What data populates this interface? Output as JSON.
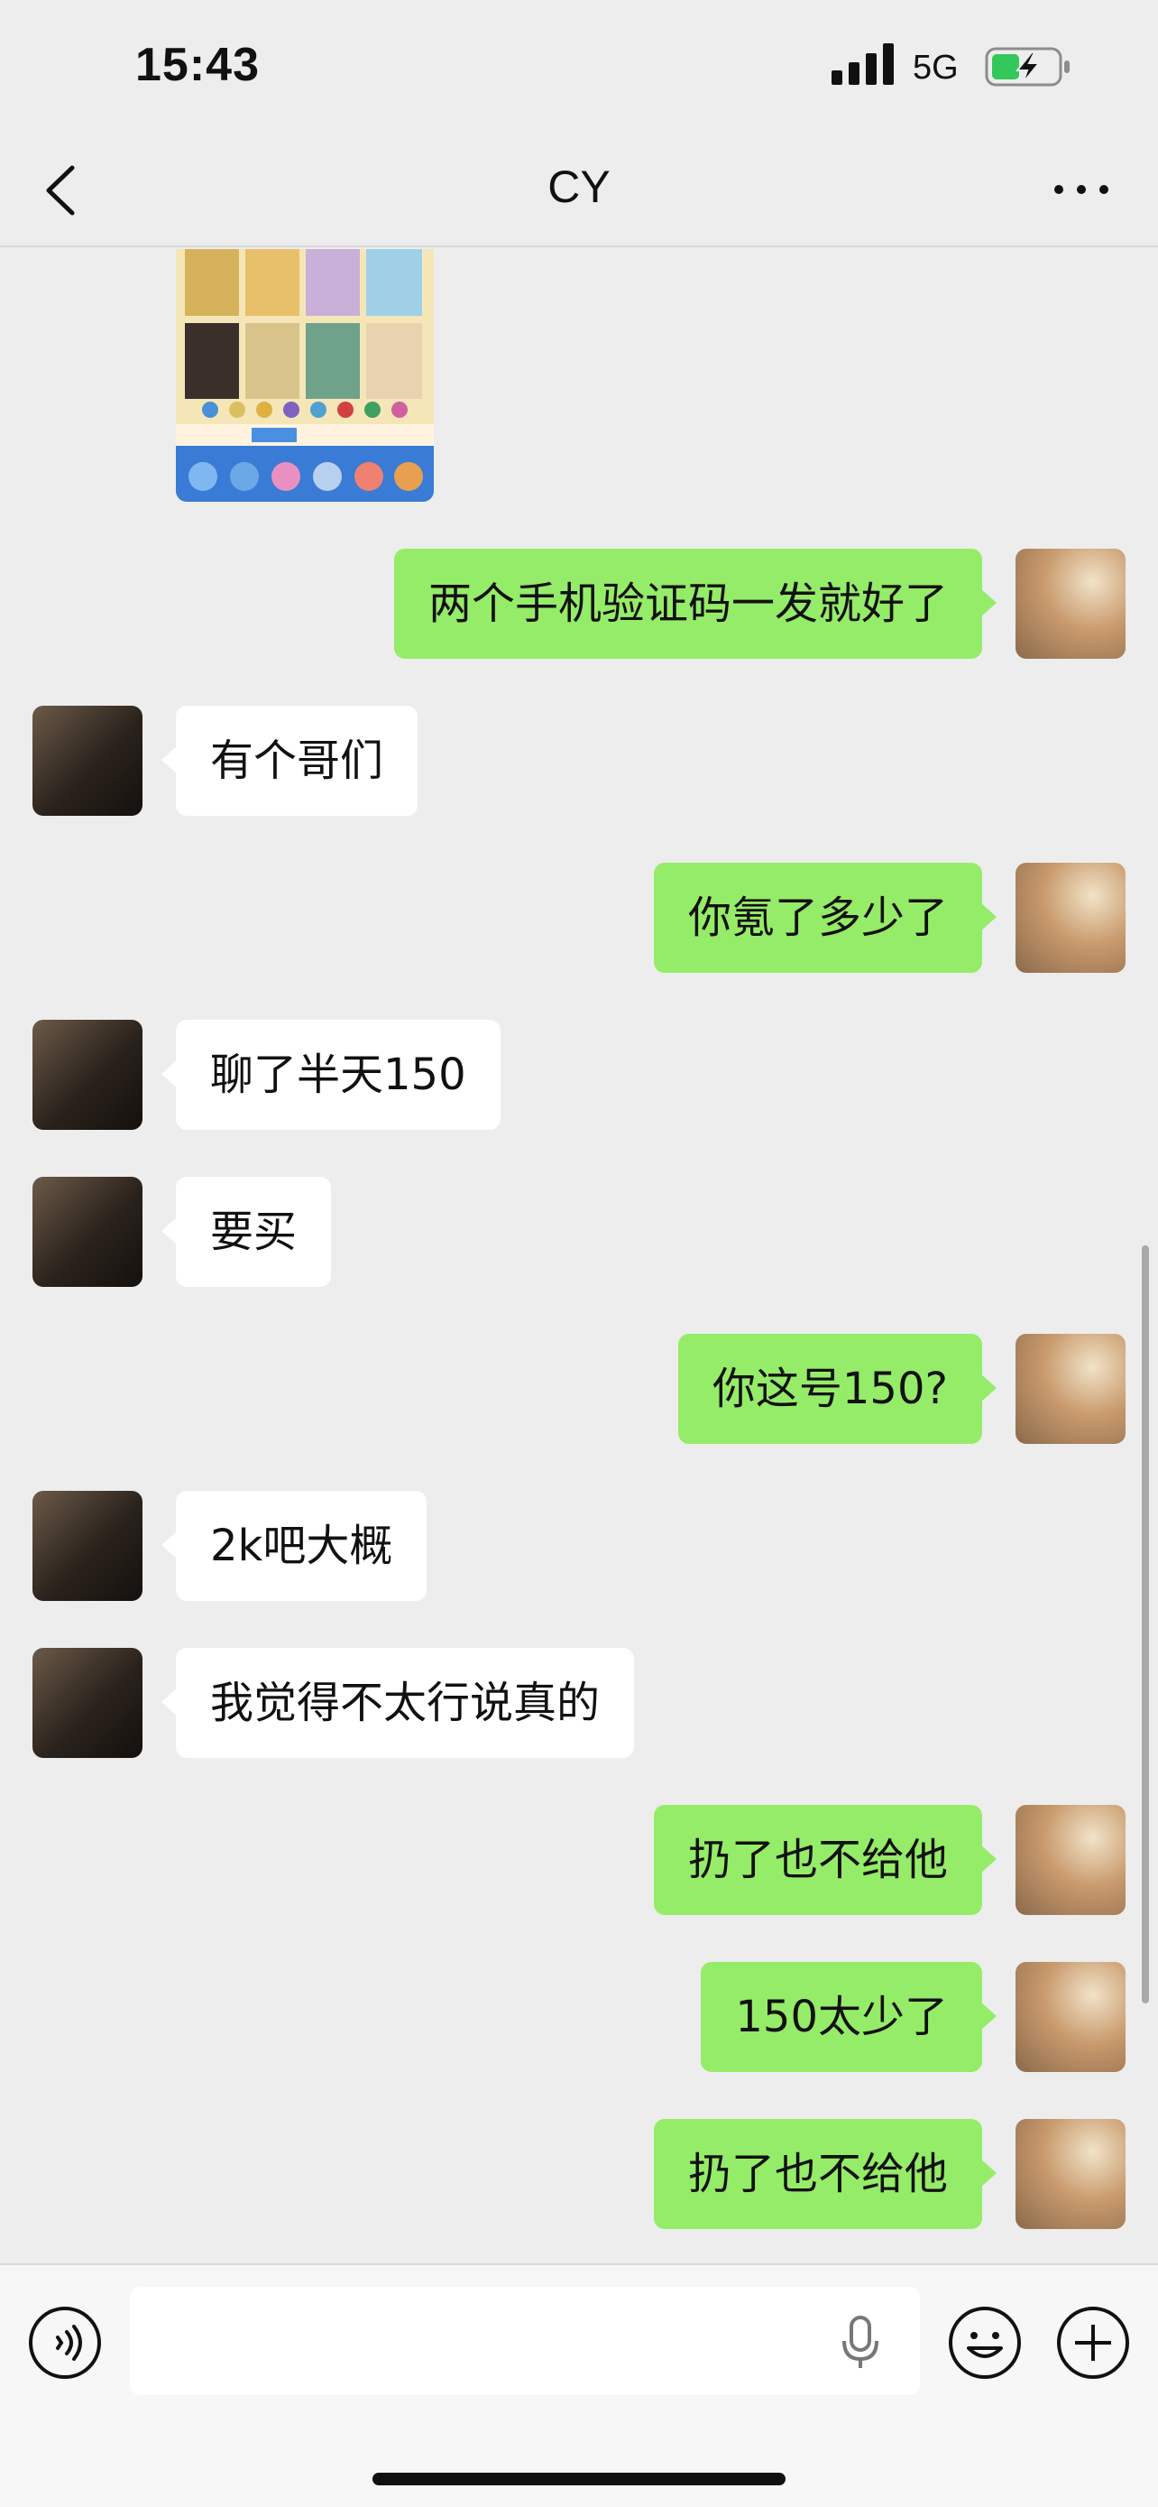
{
  "status_bar": {
    "time": "15:43",
    "network": "5G"
  },
  "nav": {
    "title": "CY"
  },
  "messages": [
    {
      "side": "right",
      "text": "两个手机验证码一发就好了"
    },
    {
      "side": "left",
      "text": "有个哥们"
    },
    {
      "side": "right",
      "text": "你氪了多少了"
    },
    {
      "side": "left",
      "text": "聊了半天150"
    },
    {
      "side": "left",
      "text": "要买"
    },
    {
      "side": "right",
      "text": "你这号150?"
    },
    {
      "side": "left",
      "text": "2k吧大概"
    },
    {
      "side": "left",
      "text": "我觉得不太行说真的"
    },
    {
      "side": "right",
      "text": "扔了也不给他"
    },
    {
      "side": "right",
      "text": "150太少了"
    },
    {
      "side": "right",
      "text": "扔了也不给他"
    }
  ],
  "colors": {
    "sent_bubble": "#95ec69",
    "received_bubble": "#ffffff",
    "background": "#ededed"
  },
  "icons": {
    "back": "chevron-left-icon",
    "more": "ellipsis-icon",
    "voice": "voice-icon",
    "mic": "microphone-icon",
    "emoji": "smiley-icon",
    "plus": "plus-icon"
  }
}
